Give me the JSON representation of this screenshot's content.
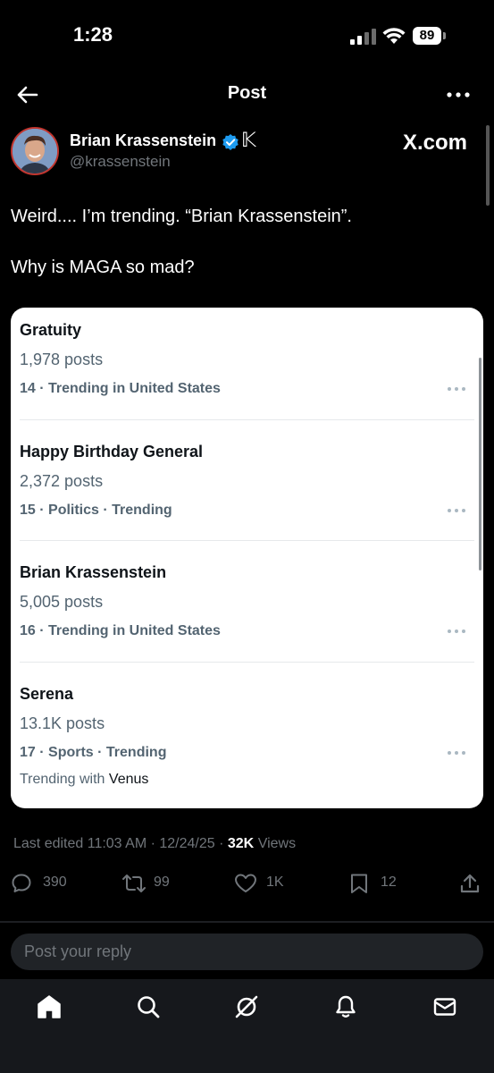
{
  "status_bar": {
    "time": "1:28",
    "battery": "89"
  },
  "header": {
    "title": "Post"
  },
  "post": {
    "author_name": "Brian Krassenstein",
    "handle": "@krassenstein",
    "source_label": "X.com",
    "text_line1": "Weird.... I’m trending. “Brian Krassenstein”.",
    "text_line2": "Why is MAGA so mad?",
    "edited_label": "Last edited 11:03 AM · 12/24/25 ·",
    "views_count": "32K",
    "views_label": "Views"
  },
  "trends": [
    {
      "name": "Gratuity",
      "posts": "1,978 posts",
      "meta": "14 · Trending in United States"
    },
    {
      "name": "Happy Birthday General",
      "posts": "2,372 posts",
      "meta": "15 · Politics · Trending"
    },
    {
      "name": "Brian Krassenstein",
      "posts": "5,005 posts",
      "meta": "16 · Trending in United States"
    },
    {
      "name": "Serena",
      "posts": "13.1K posts",
      "meta": "17 · Sports · Trending",
      "extra_prefix": "Trending with",
      "extra_value": "Venus"
    }
  ],
  "actions": {
    "replies": "390",
    "reposts": "99",
    "likes": "1K",
    "bookmarks": "12"
  },
  "reply": {
    "placeholder": "Post your reply"
  },
  "icons": {
    "back": "back-arrow-icon",
    "more": "more-icon",
    "verified": "verified-badge-icon",
    "reply": "reply-icon",
    "repost": "repost-icon",
    "like": "like-icon",
    "bookmark": "bookmark-icon",
    "share": "share-icon",
    "home": "home-icon",
    "search": "search-icon",
    "grok": "grok-icon",
    "notifications": "bell-icon",
    "messages": "mail-icon"
  },
  "colors": {
    "background": "#000000",
    "card": "#ffffff",
    "verified": "#1d9bf0",
    "muted": "#71767b"
  }
}
